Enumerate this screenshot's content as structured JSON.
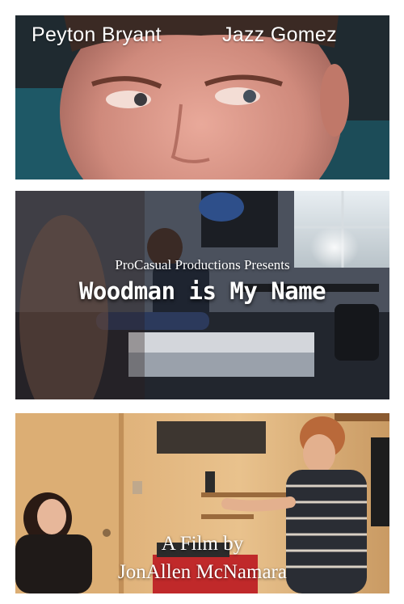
{
  "cast": {
    "name_left": "Peyton Bryant",
    "name_right": "Jazz Gomez"
  },
  "feature": {
    "presents": "ProCasual Productions Presents",
    "title": "Woodman is My Name"
  },
  "credits": {
    "line1": "A Film by",
    "line2": "JonAllen McNamara"
  },
  "colors": {
    "background": "#ffffff",
    "text": "#ffffff"
  }
}
